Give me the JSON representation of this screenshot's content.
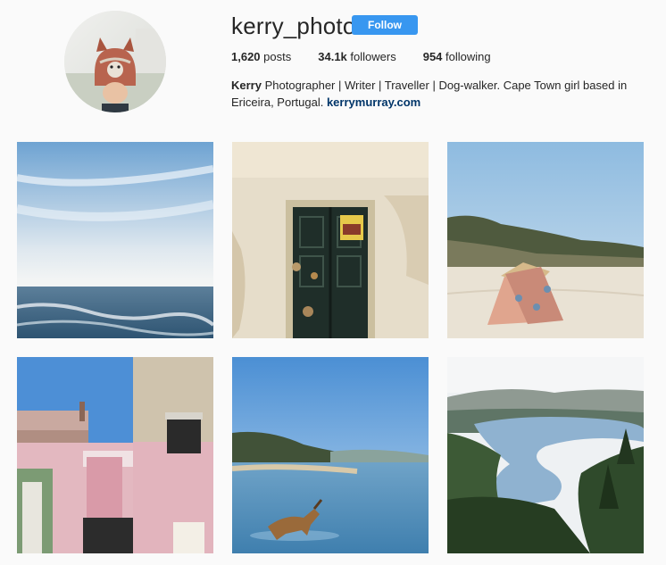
{
  "profile": {
    "username": "kerry_photo",
    "follow_label": "Follow",
    "posts_count": "1,620",
    "posts_label": "posts",
    "followers_count": "34.1k",
    "followers_label": "followers",
    "following_count": "954",
    "following_label": "following",
    "bio_name": "Kerry",
    "bio_text": "Photographer | Writer | Traveller | Dog-walker. Cape Town girl based in Ericeira, Portugal.",
    "bio_link": "kerrymurray.com"
  },
  "colors": {
    "follow_button": "#3897f0",
    "link": "#003569",
    "background": "#fafafa"
  },
  "photos": [
    {
      "subject": "ocean-sky"
    },
    {
      "subject": "weathered-door"
    },
    {
      "subject": "beach-tent"
    },
    {
      "subject": "pastel-buildings"
    },
    {
      "subject": "dog-in-water"
    },
    {
      "subject": "lake-valley"
    }
  ]
}
